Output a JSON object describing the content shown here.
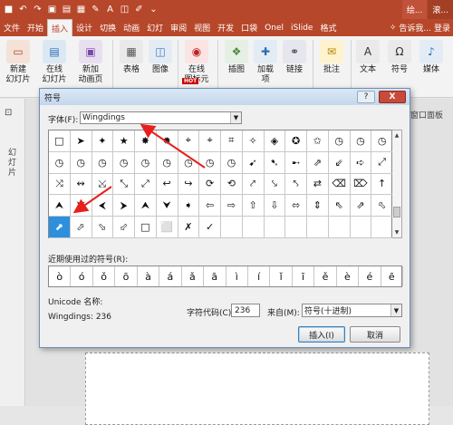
{
  "titlebar": {
    "qat_icons": [
      "save-icon",
      "undo-icon",
      "redo-icon",
      "start-icon",
      "slides-icon",
      "paste-icon",
      "brush-icon",
      "font-color-icon",
      "shapes-icon",
      "format-painter-icon",
      "more-icon"
    ],
    "tab_draw": "绘...",
    "tab_slide": "滚..."
  },
  "tabs": [
    "文件",
    "开始",
    "插入",
    "设计",
    "切换",
    "动画",
    "幻灯",
    "审阅",
    "视图",
    "开发",
    "口袋",
    "Onel",
    "iSlide",
    "格式"
  ],
  "active_tab": "插入",
  "tellme": "告诉我...",
  "login": "登录",
  "ribbon_buttons": [
    {
      "label": "新建\n幻灯片",
      "icon": "new-slide-icon"
    },
    {
      "label": "在线\n幻灯片",
      "icon": "online-slide-icon"
    },
    {
      "label": "新加\n动画页",
      "icon": "new-animation-icon"
    },
    {
      "label": "表格",
      "icon": "table-icon"
    },
    {
      "label": "图像",
      "icon": "image-icon"
    },
    {
      "label": "在线\n图标元",
      "icon": "online-icon"
    },
    {
      "label": "插图",
      "icon": "illustration-icon"
    },
    {
      "label": "加载\n项",
      "icon": "addin-icon"
    },
    {
      "label": "链接",
      "icon": "link-icon"
    },
    {
      "label": "批注",
      "icon": "comment-icon"
    },
    {
      "label": "文本",
      "icon": "text-icon"
    },
    {
      "label": "符号",
      "icon": "symbol-icon"
    },
    {
      "label": "媒体",
      "icon": "media-icon"
    }
  ],
  "hot_badge": "HOT",
  "left_pane_label": "幻灯片",
  "right_edge_text": "窗口面板",
  "dialog": {
    "title": "符号",
    "help": "?",
    "close": "X",
    "font_label": "字体(F):",
    "font_value": "Wingdings",
    "symbols": [
      "□",
      "➤",
      "✦",
      "★",
      "✸",
      "✹",
      "⌖",
      "⌖",
      "⌗",
      "✧",
      "◈",
      "✪",
      "✩",
      "◷",
      "◷",
      "◷",
      "◷",
      "◷",
      "◷",
      "◷",
      "◷",
      "◷",
      "◷",
      "◷",
      "◷",
      "➹",
      "➷",
      "➸",
      "⇗",
      "⇙",
      "➪",
      "⤢",
      "⤨",
      "↭",
      "⤩",
      "⤡",
      "⤢",
      "↩",
      "↪",
      "⟳",
      "⟲",
      "⤤",
      "⤥",
      "⤣",
      "⇄",
      "⌫",
      "⌦",
      "↑",
      "⮝",
      "⮟",
      "⮜",
      "⮞",
      "⮝",
      "⮟",
      "➧",
      "⇦",
      "⇨",
      "⇧",
      "⇩",
      "⬄",
      "⇕",
      "⇖",
      "⇗",
      "⬁",
      "⬀",
      "⬂",
      "⬃",
      "□",
      "⬜",
      "✗",
      "✓"
    ],
    "selected_symbol": "⬈",
    "recent_label": "近期使用过的符号(R):",
    "recent": [
      "ò",
      "ó",
      "ǒ",
      "ō",
      "à",
      "á",
      "ǎ",
      "ā",
      "ì",
      "í",
      "ǐ",
      "ī",
      "ě",
      "è",
      "é",
      "ē"
    ],
    "unicode_label": "Unicode 名称:",
    "unicode_value": "Wingdings: 236",
    "charcode_label": "字符代码(C):",
    "charcode_value": "236",
    "from_label": "来自(M):",
    "from_value": "符号(十进制)",
    "insert_button": "插入(I)",
    "cancel_button": "取消"
  }
}
